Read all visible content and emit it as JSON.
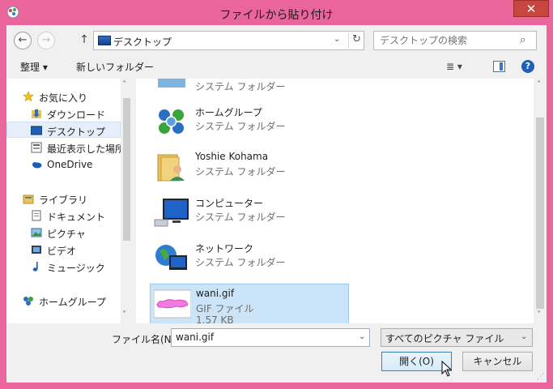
{
  "window": {
    "title": "ファイルから貼り付け",
    "close": "✕"
  },
  "nav": {
    "back": "←",
    "forward": "→",
    "up": "↑"
  },
  "address": {
    "path": "デスクトップ",
    "dropdown": "⌄",
    "refresh": "↻"
  },
  "search": {
    "placeholder": "デスクトップの検索",
    "icon": "⌕"
  },
  "toolbar": {
    "organize": "整理 ▾",
    "new_folder": "新しいフォルダー",
    "view": "≣ ▾",
    "help": "?"
  },
  "sidebar": {
    "items": [
      {
        "label": "お気に入り",
        "icon": "star-icon"
      },
      {
        "label": "ダウンロード",
        "icon": "download-folder-icon"
      },
      {
        "label": "デスクトップ",
        "icon": "desktop-icon",
        "selected": true
      },
      {
        "label": "最近表示した場所",
        "icon": "recent-places-icon"
      },
      {
        "label": "OneDrive",
        "icon": "onedrive-icon"
      },
      {
        "label": "ライブラリ",
        "icon": "library-icon"
      },
      {
        "label": "ドキュメント",
        "icon": "documents-icon"
      },
      {
        "label": "ピクチャ",
        "icon": "pictures-icon"
      },
      {
        "label": "ビデオ",
        "icon": "videos-icon"
      },
      {
        "label": "ミュージック",
        "icon": "music-icon"
      },
      {
        "label": "ホームグループ",
        "icon": "homegroup-icon"
      }
    ],
    "scroll_up": "˄",
    "scroll_down": "˅"
  },
  "files": [
    {
      "name": "ホームグループ",
      "type": "システム フォルダー",
      "icon": "homegroup-icon"
    },
    {
      "name": "Yoshie Kohama",
      "type": "システム フォルダー",
      "icon": "user-folder-icon"
    },
    {
      "name": "コンピューター",
      "type": "システム フォルダー",
      "icon": "computer-icon"
    },
    {
      "name": "ネットワーク",
      "type": "システム フォルダー",
      "icon": "network-icon"
    },
    {
      "name": "wani.gif",
      "type": "GIF ファイル",
      "size": "1.57 KB",
      "icon": "gif-thumbnail",
      "selected": true
    }
  ],
  "partial_item": {
    "type": "システム フォルダー"
  },
  "main_scroll": {
    "up": "˄",
    "down": "˅"
  },
  "bottom": {
    "filename_label": "ファイル名(N):",
    "filename_value": "wani.gif",
    "filter_value": "すべてのピクチャ ファイル",
    "dropdown": "⌄",
    "open_label": "開く(O)",
    "cancel_label": "キャンセル"
  },
  "colors": {
    "frame": "#e9659b",
    "close": "#c7463f",
    "selection": "#cce4f7"
  }
}
